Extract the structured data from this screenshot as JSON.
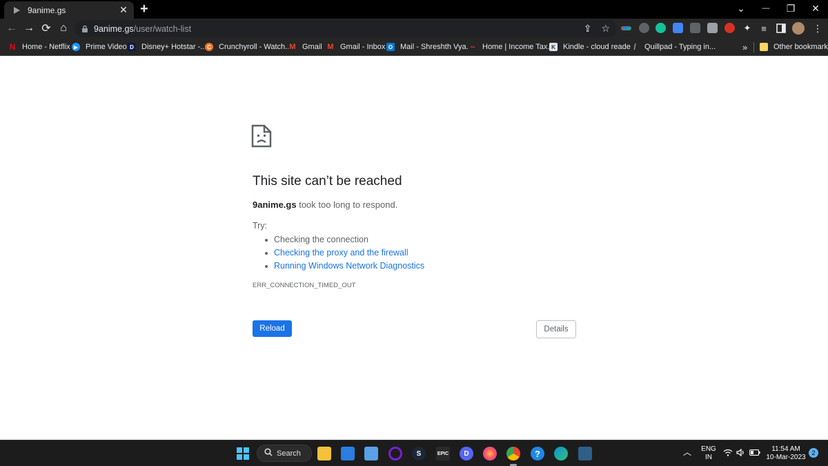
{
  "tab": {
    "title": "9anime.gs",
    "close": "✕"
  },
  "new_tab": "+",
  "window_controls": {
    "tabsearch": "⌄",
    "minimize": "—",
    "restore": "❐",
    "close": "✕"
  },
  "nav": {
    "back": "←",
    "forward": "→",
    "reload": "⟳",
    "home": "⌂"
  },
  "url": {
    "host": "9anime.gs",
    "path": "/user/watch-list"
  },
  "omnibox_icons": {
    "share": "⇪",
    "star": "☆"
  },
  "bookmarks": [
    {
      "label": "Home - Netflix",
      "icon": "netflix-icon",
      "color": "#e50914",
      "glyph": "N"
    },
    {
      "label": "Prime Video",
      "icon": "prime-video-icon",
      "color": "#1a98ff",
      "glyph": "▶"
    },
    {
      "label": "Disney+ Hotstar -...",
      "icon": "hotstar-icon",
      "color": "#0f1b4c",
      "glyph": "D"
    },
    {
      "label": "Crunchyroll - Watch...",
      "icon": "crunchyroll-icon",
      "color": "#f47521",
      "glyph": "C"
    },
    {
      "label": "Gmail",
      "icon": "gmail-icon",
      "color": "#ea4335",
      "glyph": "M"
    },
    {
      "label": "Gmail - Inbox",
      "icon": "gmail-icon",
      "color": "#ea4335",
      "glyph": "M"
    },
    {
      "label": "Mail - Shreshth Vya...",
      "icon": "outlook-icon",
      "color": "#0078d4",
      "glyph": "O"
    },
    {
      "label": "Home | Income Tax...",
      "icon": "income-tax-icon",
      "color": "#c0392b",
      "glyph": "~"
    },
    {
      "label": "Kindle - cloud reader",
      "icon": "kindle-icon",
      "color": "#232f3e",
      "glyph": "K"
    },
    {
      "label": "Quillpad - Typing in...",
      "icon": "quillpad-icon",
      "color": "#555555",
      "glyph": "/"
    }
  ],
  "bookmarks_overflow": "»",
  "other_bookmarks": "Other bookmarks",
  "error": {
    "title": "This site can’t be reached",
    "host": "9anime.gs",
    "message": " took too long to respond.",
    "try_label": "Try:",
    "tips": [
      "Checking the connection",
      "Checking the proxy and the firewall",
      "Running Windows Network Diagnostics"
    ],
    "code": "ERR_CONNECTION_TIMED_OUT",
    "reload_label": "Reload",
    "details_label": "Details"
  },
  "taskbar": {
    "search_label": "Search",
    "apps": [
      {
        "name": "file-explorer-icon",
        "color": "#f3c13a",
        "glyph": ""
      },
      {
        "name": "store-icon",
        "color": "#2a7de1",
        "glyph": ""
      },
      {
        "name": "photos-icon",
        "color": "#5aa0e6",
        "glyph": ""
      },
      {
        "name": "cortana-icon",
        "color": "#7a1fd1",
        "glyph": ""
      },
      {
        "name": "steam-icon",
        "color": "#1b2838",
        "glyph": "S"
      },
      {
        "name": "epic-games-icon",
        "color": "#2a2a2a",
        "glyph": "EPIC"
      },
      {
        "name": "discord-icon",
        "color": "#5865f2",
        "glyph": "D"
      },
      {
        "name": "firefox-icon",
        "color": "#ff7139",
        "glyph": ""
      },
      {
        "name": "chrome-icon",
        "color": "#4285f4",
        "glyph": ""
      },
      {
        "name": "help-icon",
        "color": "#1e88e5",
        "glyph": "?"
      },
      {
        "name": "edge-icon",
        "color": "#0c8fd4",
        "glyph": ""
      },
      {
        "name": "editor-icon",
        "color": "#2f5f86",
        "glyph": ""
      }
    ],
    "lang_line1": "ENG",
    "lang_line2": "IN",
    "time": "11:54 AM",
    "date": "10-Mar-2023",
    "notification_count": "2",
    "chevron": "︿"
  }
}
